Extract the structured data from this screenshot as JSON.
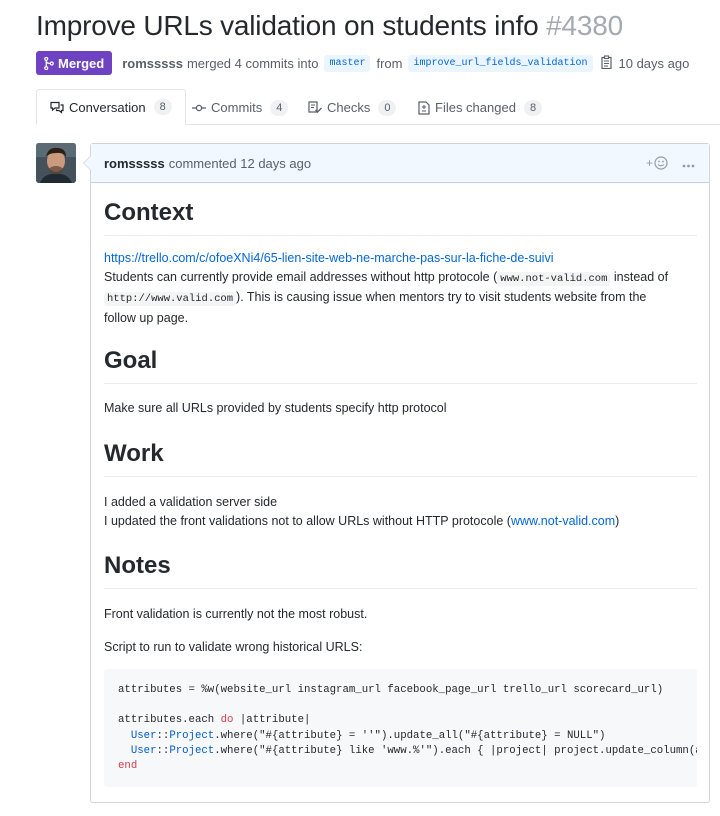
{
  "pr": {
    "title": "Improve URLs validation on students info",
    "number": "#4380",
    "status": "Merged",
    "author": "romsssss",
    "merge_text": "merged 4 commits into",
    "base_branch": "master",
    "from_text": "from",
    "head_branch": "improve_url_fields_validation",
    "time": "10 days ago"
  },
  "tabs": [
    {
      "label": "Conversation",
      "count": "8",
      "icon": "comment-discussion-icon"
    },
    {
      "label": "Commits",
      "count": "4",
      "icon": "git-commit-icon"
    },
    {
      "label": "Checks",
      "count": "0",
      "icon": "checklist-icon"
    },
    {
      "label": "Files changed",
      "count": "8",
      "icon": "file-diff-icon"
    }
  ],
  "comment": {
    "author": "romsssss",
    "action_time": "commented 12 days ago",
    "reaction_icon": "smiley-icon",
    "menu_icon": "kebab-horizontal-icon",
    "sections": {
      "context": {
        "heading": "Context",
        "link": "https://trello.com/c/ofoeXNi4/65-lien-site-web-ne-marche-pas-sur-la-fiche-de-suivi",
        "line1_a": "Students can currently provide email addresses without http protocole (",
        "code1": "www.not-valid.com",
        "line1_b": " instead of",
        "code2": "http://www.valid.com",
        "line2": "). This is causing issue when mentors try to visit students website from the",
        "line3": "follow up page."
      },
      "goal": {
        "heading": "Goal",
        "text": "Make sure all URLs provided by students specify http protocol"
      },
      "work": {
        "heading": "Work",
        "line1": "I added a validation server side",
        "line2_a": "I updated the front validations not to allow URLs without HTTP protocole (",
        "line2_link": "www.not-valid.com",
        "line2_b": ")"
      },
      "notes": {
        "heading": "Notes",
        "line1": "Front validation is currently not the most robust.",
        "line2": "Script to run to validate wrong historical URLS:"
      }
    },
    "code": {
      "l1": "attributes = %w(website_url instagram_url facebook_page_url trello_url scorecard_url)",
      "l2_a": "attributes.each ",
      "l2_kw": "do",
      "l2_b": " |attribute|",
      "l3_cls": "User",
      "l3_sep": "::",
      "l3_cls2": "Project",
      "l3_rest": ".where(\"#{attribute} = ''\").update_all(\"#{attribute} = NULL\")",
      "l4_cls": "User",
      "l4_sep": "::",
      "l4_cls2": "Project",
      "l4_rest": ".where(\"#{attribute} like 'www.%'\").each { |project| project.update_column(a",
      "l5": "end"
    }
  }
}
